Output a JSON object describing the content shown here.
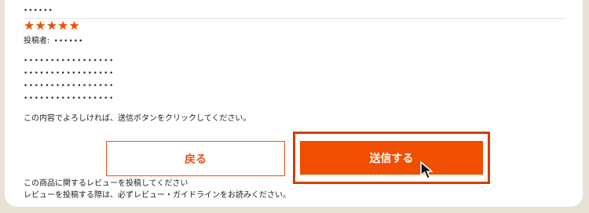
{
  "review": {
    "title_masked": "••••••",
    "rating_stars": "★★★★★",
    "rating_value": 5,
    "poster_label": "投稿者:",
    "poster_name_masked": "••••••",
    "body_lines": [
      "•••••••••••••••••",
      "•••••••••••••••••",
      "•••••••••••••••••",
      "•••••••••••••••••"
    ]
  },
  "confirm_text": "この内容でよろしければ、送信ボタンをクリックしてください。",
  "buttons": {
    "back_label": "戻る",
    "submit_label": "送信する"
  },
  "notes": [
    "この商品に関するレビューを投稿してください",
    "レビューを投稿する際は、必ずレビュー・ガイドラインをお読みください。"
  ],
  "colors": {
    "accent": "#f04e00",
    "accent_border": "#d23e00",
    "background": "#e8e2d6"
  },
  "icons": {
    "cursor": "mouse-pointer-icon"
  }
}
